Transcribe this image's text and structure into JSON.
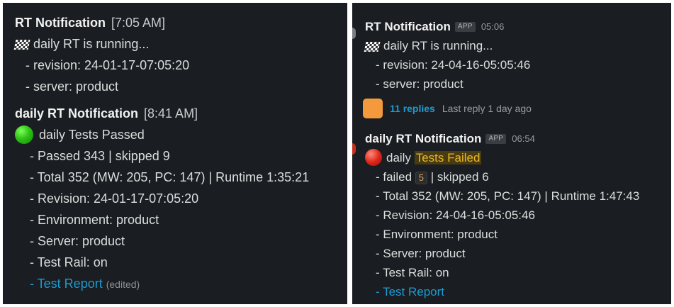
{
  "left": {
    "msg1": {
      "sender": "RT Notification",
      "time": "[7:05 AM]",
      "status": "daily RT is running...",
      "lines": [
        "- revision: 24-01-17-07:05:20",
        "- server: product"
      ]
    },
    "msg2": {
      "sender": "daily RT Notification",
      "time": "[8:41 AM]",
      "status": "daily Tests Passed",
      "lines": [
        "- Passed 343 | skipped 9",
        "- Total 352 (MW: 205, PC: 147) | Runtime 1:35:21",
        "- Revision: 24-01-17-07:05:20",
        "- Environment: product",
        "- Server: product",
        "- Test Rail: on"
      ],
      "report_prefix": "- ",
      "report_link": "Test Report",
      "edited": "(edited)"
    }
  },
  "right": {
    "msg1": {
      "sender": "RT Notification",
      "badge": "APP",
      "time": "05:06",
      "status": "daily RT is running...",
      "lines": [
        "- revision: 24-04-16-05:05:46",
        "- server: product"
      ],
      "thread": {
        "replies": "11 replies",
        "last_reply": "Last reply 1 day ago"
      }
    },
    "msg2": {
      "sender": "daily RT Notification",
      "badge": "APP",
      "time": "06:54",
      "status_prefix": "daily",
      "status_highlight": "Tests Failed",
      "failed_prefix": "- failed",
      "failed_count": "5",
      "failed_suffix": "| skipped 6",
      "lines": [
        "- Total 352 (MW: 205, PC: 147) | Runtime 1:47:43",
        "- Revision: 24-04-16-05:05:46",
        "- Environment: product",
        "- Server: product",
        "- Test Rail: on"
      ],
      "report_prefix": "- ",
      "report_link": "Test Report"
    }
  }
}
